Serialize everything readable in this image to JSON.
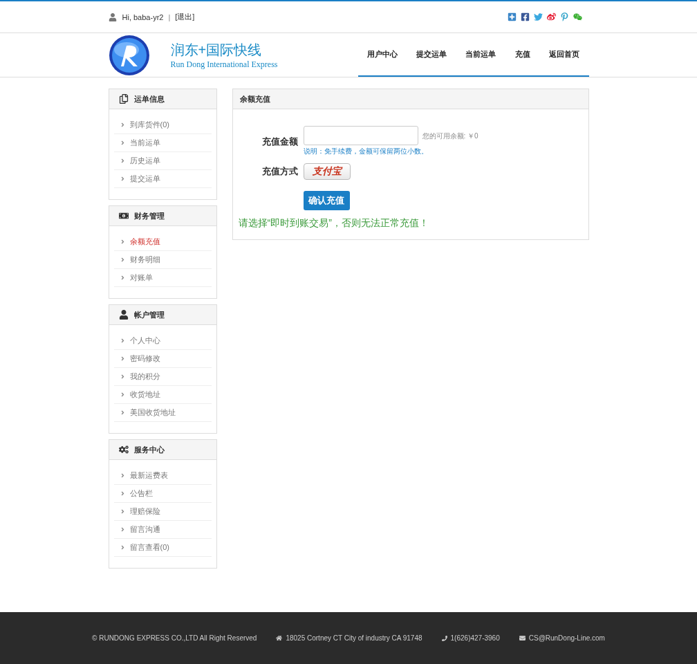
{
  "top_bar": {
    "greeting": "Hi, baba-yr2",
    "separator": "|",
    "logout": "[退出]"
  },
  "header": {
    "logo_title": "润东+国际快线",
    "logo_subtitle": "Run Dong International Express",
    "nav": [
      {
        "label": "用户中心"
      },
      {
        "label": "提交运单"
      },
      {
        "label": "当前运单"
      },
      {
        "label": "充值"
      },
      {
        "label": "返回首页"
      }
    ]
  },
  "sidebar": [
    {
      "title": "运单信息",
      "items": [
        {
          "label": "到库货件(0)",
          "selected": false
        },
        {
          "label": "当前运单",
          "selected": false
        },
        {
          "label": "历史运单",
          "selected": false
        },
        {
          "label": "提交运单",
          "selected": false
        }
      ]
    },
    {
      "title": "财务管理",
      "items": [
        {
          "label": "余额充值",
          "selected": true
        },
        {
          "label": "财务明细",
          "selected": false
        },
        {
          "label": "对账单",
          "selected": false
        }
      ]
    },
    {
      "title": "帐户管理",
      "items": [
        {
          "label": "个人中心",
          "selected": false
        },
        {
          "label": "密码修改",
          "selected": false
        },
        {
          "label": "我的积分",
          "selected": false
        },
        {
          "label": "收货地址",
          "selected": false
        },
        {
          "label": "美国收货地址",
          "selected": false
        }
      ]
    },
    {
      "title": "服务中心",
      "items": [
        {
          "label": "最新运费表",
          "selected": false
        },
        {
          "label": "公告栏",
          "selected": false
        },
        {
          "label": "理赔保险",
          "selected": false
        },
        {
          "label": "留言沟通",
          "selected": false
        },
        {
          "label": "留言查看(0)",
          "selected": false
        }
      ]
    }
  ],
  "panel": {
    "title": "余额充值",
    "amount_label": "充值金额",
    "balance": "您的可用余额: ￥0",
    "note": "说明：免手续费，金额可保留两位小数。",
    "method_label": "充值方式",
    "method_logo": "支付宝",
    "submit": "确认充值",
    "warning": "请选择“即时到账交易”，否则无法正常充值！"
  },
  "footer": {
    "copyright": "© RUNDONG EXPRESS CO.,LTD All Right Reserved",
    "address": "18025 Cortney CT City of industry CA 91748",
    "phone": "1(626)427-3960",
    "email": "CS@RunDong-Line.com"
  }
}
